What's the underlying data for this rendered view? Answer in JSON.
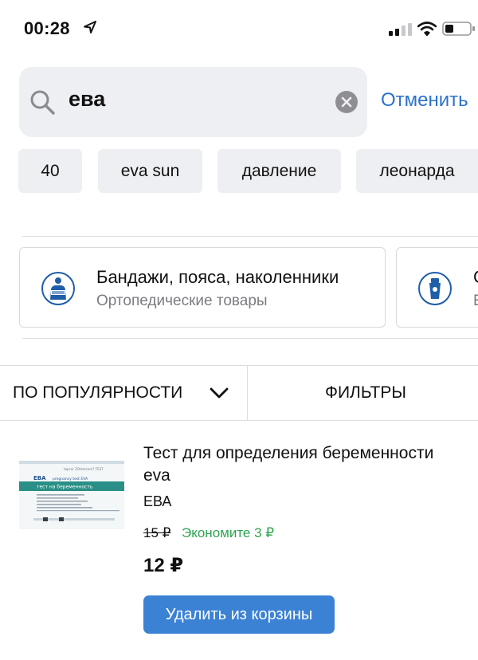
{
  "status_bar": {
    "time": "00:28",
    "icons": [
      "location-arrow-icon",
      "signal-icon",
      "wifi-icon",
      "battery-icon"
    ]
  },
  "search": {
    "value": "ева",
    "cancel_label": "Отменить",
    "icons": [
      "search-icon",
      "clear-icon"
    ]
  },
  "suggestions": [
    "40",
    "eva sun",
    "давление",
    "леонарда"
  ],
  "categories": [
    {
      "title": "Бандажи, пояса, наколенники",
      "subtitle": "Ортопедические товары",
      "icon": "orthopedic-icon"
    },
    {
      "title": "С",
      "subtitle": "Е",
      "icon": "sunscreen-icon"
    }
  ],
  "sort": {
    "label": "ПО ПОПУЛЯРНОСТИ",
    "filter_label": "ФИЛЬТРЫ"
  },
  "product": {
    "title": "Тест для определения беременности eva",
    "brand": "ЕВА",
    "old_price": "15 ₽",
    "saving": "Экономите 3 ₽",
    "price": "12 ₽",
    "button_label": "Удалить из корзины",
    "image": {
      "top_text": "tapcar ZOtestcom? TEST",
      "brand": "ЕВА",
      "subtitle": "pregnancy test EVA",
      "band_text": "тест на беременность"
    }
  },
  "colors": {
    "accent": "#2b72c8",
    "button": "#3b82d4",
    "saving": "#2ea44f",
    "chip_bg": "#eeeff2",
    "icon_blue": "#1f5fa8"
  }
}
